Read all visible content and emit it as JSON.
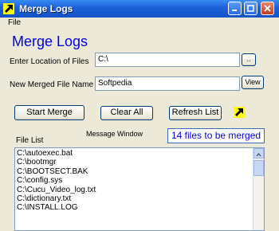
{
  "window": {
    "title": "Merge Logs"
  },
  "menu": {
    "file": "File"
  },
  "header": {
    "title": "Merge Logs"
  },
  "location": {
    "label": "Enter Location of Files",
    "value": "C:\\",
    "browse_label": ".."
  },
  "merged_file": {
    "label": "New Merged File Name",
    "value": "Softpedia",
    "view_label": "View"
  },
  "actions": {
    "start": "Start Merge",
    "clear": "Clear All",
    "refresh": "Refresh List"
  },
  "message": {
    "label": "Message Window",
    "text": "14 files to be merged"
  },
  "file_list": {
    "label": "File List",
    "items": [
      "C:\\autoexec.bat",
      "C:\\bootmgr",
      "C:\\BOOTSECT.BAK",
      "C:\\config.sys",
      "C:\\Cucu_Video_log.txt",
      "C:\\dictionary.txt",
      "C:\\INSTALL.LOG"
    ]
  },
  "icons": {
    "app": "yellow-arrow-icon",
    "minimize": "minimize-icon",
    "maximize": "maximize-icon",
    "close": "close-icon",
    "action": "yellow-arrow-icon"
  },
  "colors": {
    "title_blue": "#0000e0",
    "titlebar": "#1b5fd6",
    "window_bg": "#ece9d8"
  }
}
